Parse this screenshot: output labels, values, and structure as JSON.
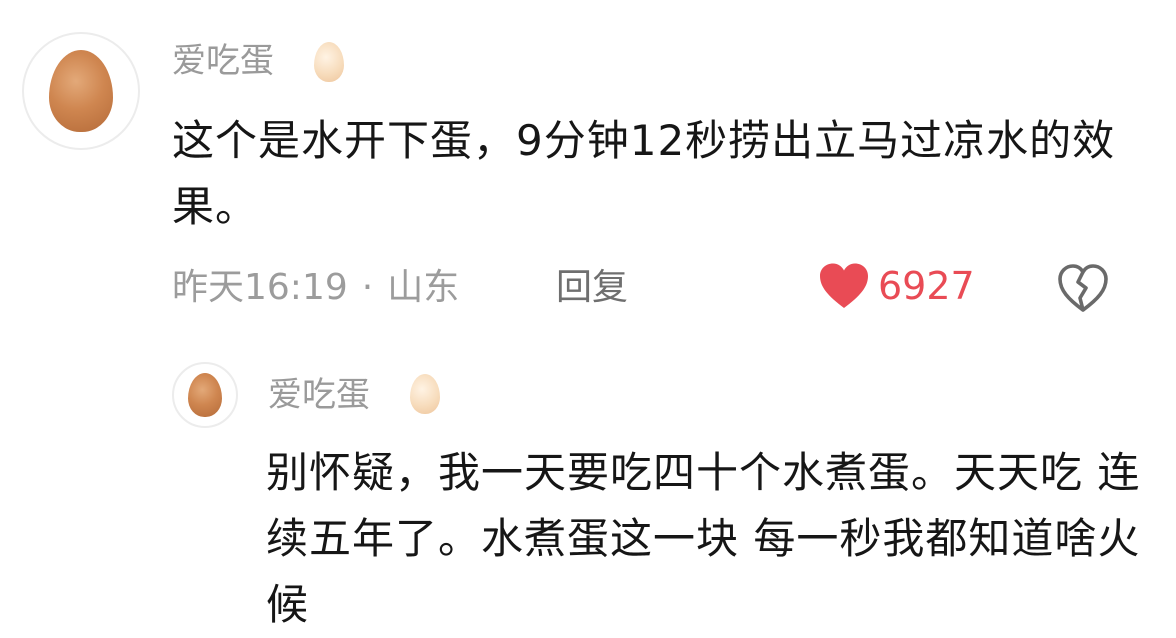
{
  "main_comment": {
    "username": "爱吃蛋",
    "avatar_icon": "egg-avatar-icon",
    "name_emoji": "egg-emoji-icon",
    "text": "这个是水开下蛋，9分钟12秒捞出立马过凉水的效果。",
    "time": "昨天16:19",
    "separator": "·",
    "location": "山东",
    "reply_label": "回复",
    "like_count": "6927",
    "like_icon": "heart-icon",
    "dislike_icon": "broken-heart-icon",
    "like_color": "#e94b55"
  },
  "reply_comment": {
    "username": "爱吃蛋",
    "avatar_icon": "egg-avatar-icon",
    "name_emoji": "egg-emoji-icon",
    "text": "别怀疑，我一天要吃四十个水煮蛋。天天吃 连续五年了。水煮蛋这一块 每一秒我都知道啥火候"
  }
}
